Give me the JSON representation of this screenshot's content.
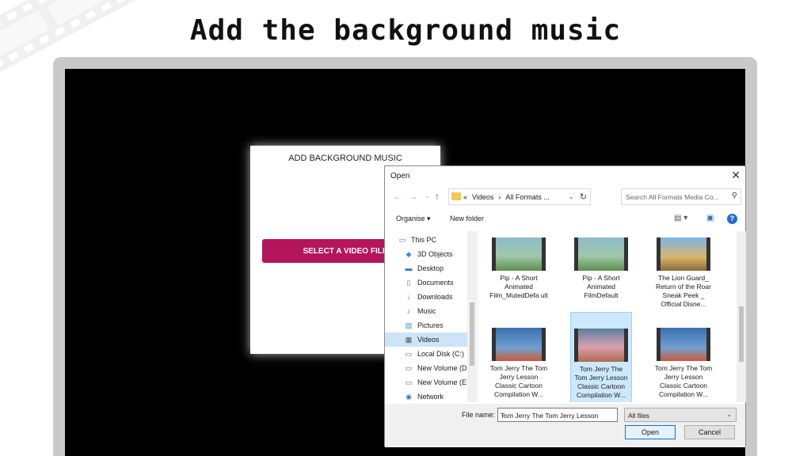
{
  "headline": "Add the background music",
  "app": {
    "title": "ADD BACKGROUND MUSIC",
    "select_button": "SELECT A VIDEO FILE"
  },
  "dialog": {
    "title": "Open",
    "close": "✕",
    "breadcrumb": [
      "«",
      "Videos",
      "›",
      "All Formats ..."
    ],
    "search_placeholder": "Search All Formats Media Co...",
    "toolbar": {
      "organise": "Organise ▾",
      "new_folder": "New folder"
    },
    "nav_items": [
      {
        "label": "This PC",
        "icon": "computer-icon"
      },
      {
        "label": "3D Objects",
        "icon": "cube-icon"
      },
      {
        "label": "Desktop",
        "icon": "desktop-icon"
      },
      {
        "label": "Documents",
        "icon": "document-icon"
      },
      {
        "label": "Downloads",
        "icon": "download-icon"
      },
      {
        "label": "Music",
        "icon": "music-icon"
      },
      {
        "label": "Pictures",
        "icon": "picture-icon"
      },
      {
        "label": "Videos",
        "icon": "video-icon",
        "selected": true
      },
      {
        "label": "Local Disk (C:)",
        "icon": "drive-icon"
      },
      {
        "label": "New Volume (D:",
        "icon": "drive-icon"
      },
      {
        "label": "New Volume (E:)",
        "icon": "drive-icon"
      },
      {
        "label": "Network",
        "icon": "network-icon"
      }
    ],
    "files": [
      {
        "caption": "Pip - A Short Animated Film_MutedDefa ult",
        "scene": "pip-green"
      },
      {
        "caption": "Pip - A Short Animated FilmDefault",
        "scene": "pip-green"
      },
      {
        "caption": "The Lion Guard_ Return of the Roar Sneak Peek _ Official Disne...",
        "scene": "lion"
      },
      {
        "caption": "Tom  Jerry  The Tom  Jerry Lesson Classic Cartoon Compilation  W...",
        "scene": "tom-blue"
      },
      {
        "caption": "Tom  Jerry  The Tom  Jerry Lesson Classic Cartoon Compilation  W...",
        "scene": "tom-pink",
        "selected": true
      },
      {
        "caption": "Tom  Jerry  The Tom  Jerry Lesson Classic Cartoon Compilation  W...",
        "scene": "tom-blue"
      }
    ],
    "file_name_label": "File name:",
    "file_name_value": "Tom  Jerry  The Tom  Jerry Lesson",
    "filter_value": "All files",
    "open_button": "Open",
    "cancel_button": "Cancel"
  },
  "colors": {
    "accent_button": "#b5155a",
    "selection": "#cce4f7",
    "device_frame": "#c9c9c9"
  }
}
